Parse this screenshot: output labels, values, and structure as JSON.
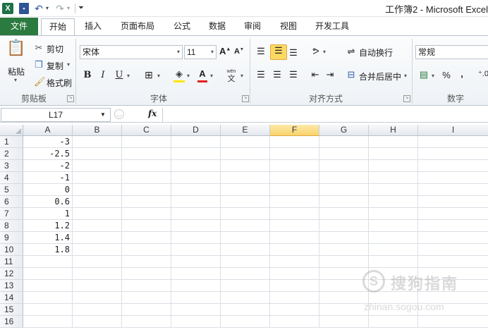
{
  "titlebar": {
    "title": "工作簿2 - Microsoft Excel",
    "app_icon": "X",
    "icons": [
      "excel-logo-icon",
      "save-icon",
      "undo-icon",
      "redo-icon",
      "customize-icon"
    ]
  },
  "tabs": [
    {
      "label": "文件"
    },
    {
      "label": "开始"
    },
    {
      "label": "插入"
    },
    {
      "label": "页面布局"
    },
    {
      "label": "公式"
    },
    {
      "label": "数据"
    },
    {
      "label": "审阅"
    },
    {
      "label": "视图"
    },
    {
      "label": "开发工具"
    }
  ],
  "ribbon": {
    "clipboard": {
      "paste": "粘贴",
      "cut": "剪切",
      "copy": "复制",
      "format_painter": "格式刷",
      "label": "剪贴板"
    },
    "font": {
      "name": "宋体",
      "size": "11",
      "bold": "B",
      "italic": "I",
      "underline": "U",
      "label": "字体",
      "wen": "wén"
    },
    "alignment": {
      "wrap": "自动换行",
      "merge": "合并后居中",
      "label": "对齐方式"
    },
    "number": {
      "format": "常规",
      "percent": "%",
      "comma": ",",
      "label": "数字"
    }
  },
  "formula_bar": {
    "name_box": "L17",
    "fx": "fx",
    "value": ""
  },
  "columns": [
    "A",
    "B",
    "C",
    "D",
    "E",
    "F",
    "G",
    "H",
    "I"
  ],
  "selected_column": "F",
  "rows": [
    "1",
    "2",
    "3",
    "4",
    "5",
    "6",
    "7",
    "8",
    "9",
    "10",
    "11",
    "12",
    "13",
    "14",
    "15",
    "16"
  ],
  "column_a_values": [
    "-3",
    "-2.5",
    "-2",
    "-1",
    "0",
    "0.6",
    "1",
    "1.2",
    "1.4",
    "1.8",
    "",
    "",
    "",
    "",
    "",
    ""
  ],
  "watermark": {
    "logo": "S",
    "text": "搜狗指南",
    "url": "zhinan.sogou.com"
  },
  "colors": {
    "file_tab": "#2b7a3f",
    "selected_header": "#f8d36b",
    "highlight": "#fbd961"
  }
}
